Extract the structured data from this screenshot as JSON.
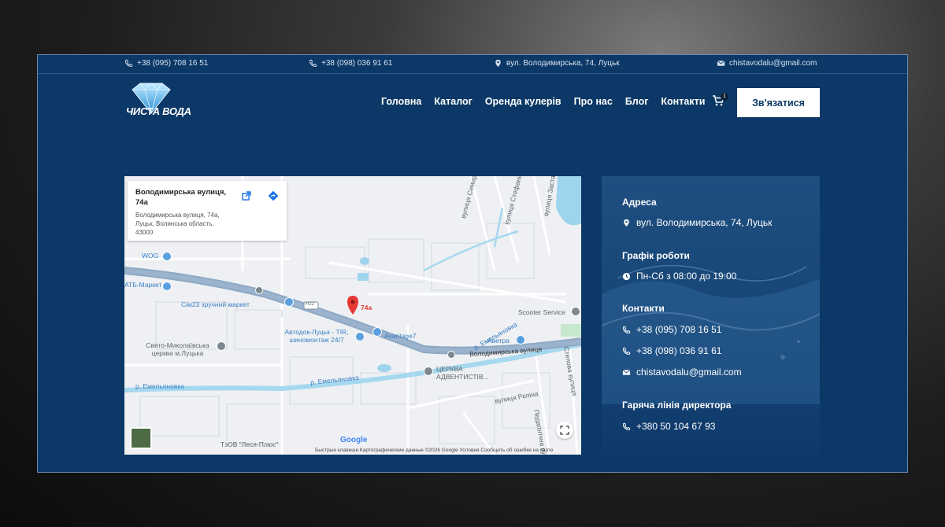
{
  "topbar": {
    "phone1": "+38 (095) 708 16 51",
    "phone2": "+38 (098) 036 91 61",
    "address": "вул. Володимирська, 74, Луцьк",
    "email": "chistavodalu@gmail.com"
  },
  "logo": {
    "text": "ЧИСТА ВОДА"
  },
  "nav": {
    "items": [
      "Головна",
      "Каталог",
      "Оренда кулерів",
      "Про нас",
      "Блог",
      "Контакти"
    ]
  },
  "cart": {
    "count": "1"
  },
  "cta": {
    "label": "Зв'язатися"
  },
  "map": {
    "card_title": "Володимирська вулиця, 74а",
    "card_address": "Володимирська вулиця, 74а, Луцьк, Волинська область, 43000",
    "pin_label": "74а",
    "labels": {
      "wog": "WOG",
      "atb": "АТБ-Маркет",
      "sim23": "Сім23 зручний маркет",
      "avtodok": "Автодок-Луцьк - TIR, шиномонтаж 24/7",
      "avantage": "Avantage7",
      "scooter": "Scooter Service",
      "avetra": "Аветра",
      "church1": "Свято-Миколаївська церква м.Луцька",
      "church2": "ЦЕРКВА АДВЕНТИСТІВ...",
      "street_main": "Володимирська вулиця",
      "river1": "р. Емельяновка",
      "river2": "р. Емельяновка",
      "river3": "р. Емельяновка",
      "repina": "вулиця Рєпіна",
      "simyrenka": "вулиця Симиренка",
      "stefanyka": "вулиця Стефаника",
      "zastavna": "вулиця Заставна",
      "stepova": "Степова вулиця",
      "pedagogichna": "Педагогічна вулиця",
      "road_code": "Н22",
      "tzov": "ТзОВ \"Леся-Плюс\""
    },
    "google": "Google",
    "attribution": "Быстрые клавиши    Картографические данные ©2026 Google    Условия    Сообщить об ошибке на карте"
  },
  "panel": {
    "address_title": "Адреса",
    "address": "вул. Володимирська, 74, Луцьк",
    "hours_title": "Графік роботи",
    "hours": "Пн-Сб з 08:00 до 19:00",
    "contacts_title": "Контакти",
    "phone1": "+38 (095) 708 16 51",
    "phone2": "+38 (098) 036 91 61",
    "email": "chistavodalu@gmail.com",
    "hotline_title": "Гаряча лінія директора",
    "hotline": "+380 50 104 67 93"
  },
  "colors": {
    "brand": "#0b3866",
    "panel": "#174677",
    "accent": "#5aa0e0",
    "pin": "#e53935"
  }
}
